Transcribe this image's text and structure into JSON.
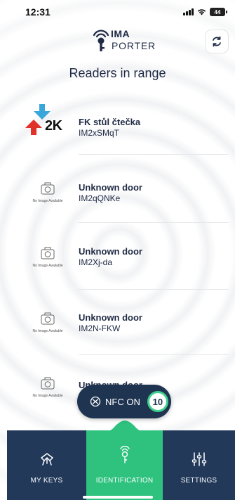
{
  "status_bar": {
    "time": "12:31",
    "battery": "44"
  },
  "header": {
    "logo_line1": "IMA",
    "logo_line2": "PORTER"
  },
  "page": {
    "title": "Readers in range"
  },
  "readers": [
    {
      "name": "FK stůl čtečka",
      "id": "IM2xSMqT",
      "thumbnail": "2k-logo"
    },
    {
      "name": "Unknown door",
      "id": "IM2qQNKe",
      "thumbnail": "no-image",
      "no_image_caption": "No Image Available"
    },
    {
      "name": "Unknown door",
      "id": "IM2Xj-da",
      "thumbnail": "no-image",
      "no_image_caption": "No Image Available"
    },
    {
      "name": "Unknown door",
      "id": "IM2N-FKW",
      "thumbnail": "no-image",
      "no_image_caption": "No Image Available"
    },
    {
      "name": "Unknown door",
      "id": "",
      "thumbnail": "no-image",
      "no_image_caption": "No Image Available"
    }
  ],
  "logo_2k": {
    "text": "2K"
  },
  "nfc": {
    "label": "NFC ON",
    "counter": "10"
  },
  "nav": {
    "items": [
      {
        "label": "MY KEYS",
        "icon": "keys-icon",
        "active": false
      },
      {
        "label": "IDENTIFICATION",
        "icon": "key-fob-icon",
        "active": true
      },
      {
        "label": "SETTINGS",
        "icon": "sliders-icon",
        "active": false
      }
    ]
  },
  "colors": {
    "accent": "#2ec27e",
    "nav_bg": "#22395a",
    "pill_bg": "#1e3450",
    "text": "#1f2a44"
  }
}
